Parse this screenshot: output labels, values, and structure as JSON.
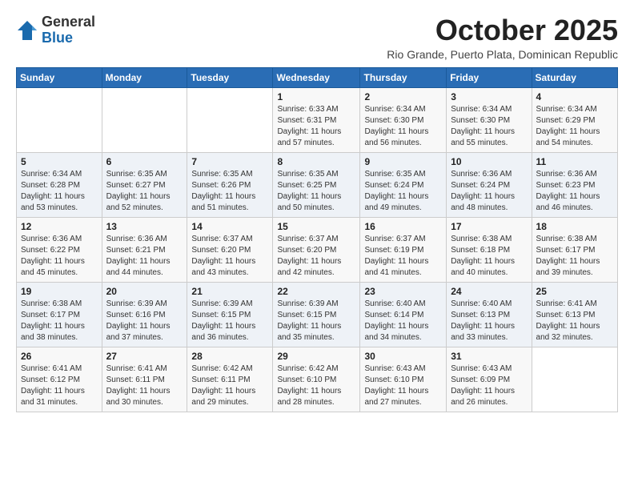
{
  "logo": {
    "general": "General",
    "blue": "Blue"
  },
  "title": "October 2025",
  "subtitle": "Rio Grande, Puerto Plata, Dominican Republic",
  "header": {
    "days": [
      "Sunday",
      "Monday",
      "Tuesday",
      "Wednesday",
      "Thursday",
      "Friday",
      "Saturday"
    ]
  },
  "weeks": [
    [
      {
        "day": "",
        "sunrise": "",
        "sunset": "",
        "daylight": ""
      },
      {
        "day": "",
        "sunrise": "",
        "sunset": "",
        "daylight": ""
      },
      {
        "day": "",
        "sunrise": "",
        "sunset": "",
        "daylight": ""
      },
      {
        "day": "1",
        "sunrise": "Sunrise: 6:33 AM",
        "sunset": "Sunset: 6:31 PM",
        "daylight": "Daylight: 11 hours and 57 minutes."
      },
      {
        "day": "2",
        "sunrise": "Sunrise: 6:34 AM",
        "sunset": "Sunset: 6:30 PM",
        "daylight": "Daylight: 11 hours and 56 minutes."
      },
      {
        "day": "3",
        "sunrise": "Sunrise: 6:34 AM",
        "sunset": "Sunset: 6:30 PM",
        "daylight": "Daylight: 11 hours and 55 minutes."
      },
      {
        "day": "4",
        "sunrise": "Sunrise: 6:34 AM",
        "sunset": "Sunset: 6:29 PM",
        "daylight": "Daylight: 11 hours and 54 minutes."
      }
    ],
    [
      {
        "day": "5",
        "sunrise": "Sunrise: 6:34 AM",
        "sunset": "Sunset: 6:28 PM",
        "daylight": "Daylight: 11 hours and 53 minutes."
      },
      {
        "day": "6",
        "sunrise": "Sunrise: 6:35 AM",
        "sunset": "Sunset: 6:27 PM",
        "daylight": "Daylight: 11 hours and 52 minutes."
      },
      {
        "day": "7",
        "sunrise": "Sunrise: 6:35 AM",
        "sunset": "Sunset: 6:26 PM",
        "daylight": "Daylight: 11 hours and 51 minutes."
      },
      {
        "day": "8",
        "sunrise": "Sunrise: 6:35 AM",
        "sunset": "Sunset: 6:25 PM",
        "daylight": "Daylight: 11 hours and 50 minutes."
      },
      {
        "day": "9",
        "sunrise": "Sunrise: 6:35 AM",
        "sunset": "Sunset: 6:24 PM",
        "daylight": "Daylight: 11 hours and 49 minutes."
      },
      {
        "day": "10",
        "sunrise": "Sunrise: 6:36 AM",
        "sunset": "Sunset: 6:24 PM",
        "daylight": "Daylight: 11 hours and 48 minutes."
      },
      {
        "day": "11",
        "sunrise": "Sunrise: 6:36 AM",
        "sunset": "Sunset: 6:23 PM",
        "daylight": "Daylight: 11 hours and 46 minutes."
      }
    ],
    [
      {
        "day": "12",
        "sunrise": "Sunrise: 6:36 AM",
        "sunset": "Sunset: 6:22 PM",
        "daylight": "Daylight: 11 hours and 45 minutes."
      },
      {
        "day": "13",
        "sunrise": "Sunrise: 6:36 AM",
        "sunset": "Sunset: 6:21 PM",
        "daylight": "Daylight: 11 hours and 44 minutes."
      },
      {
        "day": "14",
        "sunrise": "Sunrise: 6:37 AM",
        "sunset": "Sunset: 6:20 PM",
        "daylight": "Daylight: 11 hours and 43 minutes."
      },
      {
        "day": "15",
        "sunrise": "Sunrise: 6:37 AM",
        "sunset": "Sunset: 6:20 PM",
        "daylight": "Daylight: 11 hours and 42 minutes."
      },
      {
        "day": "16",
        "sunrise": "Sunrise: 6:37 AM",
        "sunset": "Sunset: 6:19 PM",
        "daylight": "Daylight: 11 hours and 41 minutes."
      },
      {
        "day": "17",
        "sunrise": "Sunrise: 6:38 AM",
        "sunset": "Sunset: 6:18 PM",
        "daylight": "Daylight: 11 hours and 40 minutes."
      },
      {
        "day": "18",
        "sunrise": "Sunrise: 6:38 AM",
        "sunset": "Sunset: 6:17 PM",
        "daylight": "Daylight: 11 hours and 39 minutes."
      }
    ],
    [
      {
        "day": "19",
        "sunrise": "Sunrise: 6:38 AM",
        "sunset": "Sunset: 6:17 PM",
        "daylight": "Daylight: 11 hours and 38 minutes."
      },
      {
        "day": "20",
        "sunrise": "Sunrise: 6:39 AM",
        "sunset": "Sunset: 6:16 PM",
        "daylight": "Daylight: 11 hours and 37 minutes."
      },
      {
        "day": "21",
        "sunrise": "Sunrise: 6:39 AM",
        "sunset": "Sunset: 6:15 PM",
        "daylight": "Daylight: 11 hours and 36 minutes."
      },
      {
        "day": "22",
        "sunrise": "Sunrise: 6:39 AM",
        "sunset": "Sunset: 6:15 PM",
        "daylight": "Daylight: 11 hours and 35 minutes."
      },
      {
        "day": "23",
        "sunrise": "Sunrise: 6:40 AM",
        "sunset": "Sunset: 6:14 PM",
        "daylight": "Daylight: 11 hours and 34 minutes."
      },
      {
        "day": "24",
        "sunrise": "Sunrise: 6:40 AM",
        "sunset": "Sunset: 6:13 PM",
        "daylight": "Daylight: 11 hours and 33 minutes."
      },
      {
        "day": "25",
        "sunrise": "Sunrise: 6:41 AM",
        "sunset": "Sunset: 6:13 PM",
        "daylight": "Daylight: 11 hours and 32 minutes."
      }
    ],
    [
      {
        "day": "26",
        "sunrise": "Sunrise: 6:41 AM",
        "sunset": "Sunset: 6:12 PM",
        "daylight": "Daylight: 11 hours and 31 minutes."
      },
      {
        "day": "27",
        "sunrise": "Sunrise: 6:41 AM",
        "sunset": "Sunset: 6:11 PM",
        "daylight": "Daylight: 11 hours and 30 minutes."
      },
      {
        "day": "28",
        "sunrise": "Sunrise: 6:42 AM",
        "sunset": "Sunset: 6:11 PM",
        "daylight": "Daylight: 11 hours and 29 minutes."
      },
      {
        "day": "29",
        "sunrise": "Sunrise: 6:42 AM",
        "sunset": "Sunset: 6:10 PM",
        "daylight": "Daylight: 11 hours and 28 minutes."
      },
      {
        "day": "30",
        "sunrise": "Sunrise: 6:43 AM",
        "sunset": "Sunset: 6:10 PM",
        "daylight": "Daylight: 11 hours and 27 minutes."
      },
      {
        "day": "31",
        "sunrise": "Sunrise: 6:43 AM",
        "sunset": "Sunset: 6:09 PM",
        "daylight": "Daylight: 11 hours and 26 minutes."
      },
      {
        "day": "",
        "sunrise": "",
        "sunset": "",
        "daylight": ""
      }
    ]
  ]
}
